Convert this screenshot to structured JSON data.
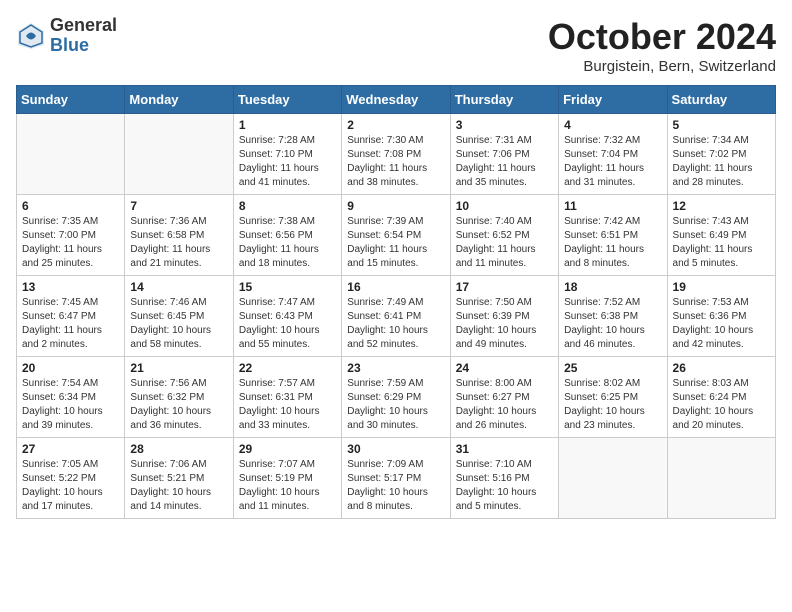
{
  "header": {
    "logo_general": "General",
    "logo_blue": "Blue",
    "month_title": "October 2024",
    "location": "Burgistein, Bern, Switzerland"
  },
  "days_of_week": [
    "Sunday",
    "Monday",
    "Tuesday",
    "Wednesday",
    "Thursday",
    "Friday",
    "Saturday"
  ],
  "weeks": [
    [
      {
        "day": "",
        "empty": true
      },
      {
        "day": "",
        "empty": true
      },
      {
        "day": "1",
        "lines": [
          "Sunrise: 7:28 AM",
          "Sunset: 7:10 PM",
          "Daylight: 11 hours",
          "and 41 minutes."
        ]
      },
      {
        "day": "2",
        "lines": [
          "Sunrise: 7:30 AM",
          "Sunset: 7:08 PM",
          "Daylight: 11 hours",
          "and 38 minutes."
        ]
      },
      {
        "day": "3",
        "lines": [
          "Sunrise: 7:31 AM",
          "Sunset: 7:06 PM",
          "Daylight: 11 hours",
          "and 35 minutes."
        ]
      },
      {
        "day": "4",
        "lines": [
          "Sunrise: 7:32 AM",
          "Sunset: 7:04 PM",
          "Daylight: 11 hours",
          "and 31 minutes."
        ]
      },
      {
        "day": "5",
        "lines": [
          "Sunrise: 7:34 AM",
          "Sunset: 7:02 PM",
          "Daylight: 11 hours",
          "and 28 minutes."
        ]
      }
    ],
    [
      {
        "day": "6",
        "lines": [
          "Sunrise: 7:35 AM",
          "Sunset: 7:00 PM",
          "Daylight: 11 hours",
          "and 25 minutes."
        ]
      },
      {
        "day": "7",
        "lines": [
          "Sunrise: 7:36 AM",
          "Sunset: 6:58 PM",
          "Daylight: 11 hours",
          "and 21 minutes."
        ]
      },
      {
        "day": "8",
        "lines": [
          "Sunrise: 7:38 AM",
          "Sunset: 6:56 PM",
          "Daylight: 11 hours",
          "and 18 minutes."
        ]
      },
      {
        "day": "9",
        "lines": [
          "Sunrise: 7:39 AM",
          "Sunset: 6:54 PM",
          "Daylight: 11 hours",
          "and 15 minutes."
        ]
      },
      {
        "day": "10",
        "lines": [
          "Sunrise: 7:40 AM",
          "Sunset: 6:52 PM",
          "Daylight: 11 hours",
          "and 11 minutes."
        ]
      },
      {
        "day": "11",
        "lines": [
          "Sunrise: 7:42 AM",
          "Sunset: 6:51 PM",
          "Daylight: 11 hours",
          "and 8 minutes."
        ]
      },
      {
        "day": "12",
        "lines": [
          "Sunrise: 7:43 AM",
          "Sunset: 6:49 PM",
          "Daylight: 11 hours",
          "and 5 minutes."
        ]
      }
    ],
    [
      {
        "day": "13",
        "lines": [
          "Sunrise: 7:45 AM",
          "Sunset: 6:47 PM",
          "Daylight: 11 hours",
          "and 2 minutes."
        ]
      },
      {
        "day": "14",
        "lines": [
          "Sunrise: 7:46 AM",
          "Sunset: 6:45 PM",
          "Daylight: 10 hours",
          "and 58 minutes."
        ]
      },
      {
        "day": "15",
        "lines": [
          "Sunrise: 7:47 AM",
          "Sunset: 6:43 PM",
          "Daylight: 10 hours",
          "and 55 minutes."
        ]
      },
      {
        "day": "16",
        "lines": [
          "Sunrise: 7:49 AM",
          "Sunset: 6:41 PM",
          "Daylight: 10 hours",
          "and 52 minutes."
        ]
      },
      {
        "day": "17",
        "lines": [
          "Sunrise: 7:50 AM",
          "Sunset: 6:39 PM",
          "Daylight: 10 hours",
          "and 49 minutes."
        ]
      },
      {
        "day": "18",
        "lines": [
          "Sunrise: 7:52 AM",
          "Sunset: 6:38 PM",
          "Daylight: 10 hours",
          "and 46 minutes."
        ]
      },
      {
        "day": "19",
        "lines": [
          "Sunrise: 7:53 AM",
          "Sunset: 6:36 PM",
          "Daylight: 10 hours",
          "and 42 minutes."
        ]
      }
    ],
    [
      {
        "day": "20",
        "lines": [
          "Sunrise: 7:54 AM",
          "Sunset: 6:34 PM",
          "Daylight: 10 hours",
          "and 39 minutes."
        ]
      },
      {
        "day": "21",
        "lines": [
          "Sunrise: 7:56 AM",
          "Sunset: 6:32 PM",
          "Daylight: 10 hours",
          "and 36 minutes."
        ]
      },
      {
        "day": "22",
        "lines": [
          "Sunrise: 7:57 AM",
          "Sunset: 6:31 PM",
          "Daylight: 10 hours",
          "and 33 minutes."
        ]
      },
      {
        "day": "23",
        "lines": [
          "Sunrise: 7:59 AM",
          "Sunset: 6:29 PM",
          "Daylight: 10 hours",
          "and 30 minutes."
        ]
      },
      {
        "day": "24",
        "lines": [
          "Sunrise: 8:00 AM",
          "Sunset: 6:27 PM",
          "Daylight: 10 hours",
          "and 26 minutes."
        ]
      },
      {
        "day": "25",
        "lines": [
          "Sunrise: 8:02 AM",
          "Sunset: 6:25 PM",
          "Daylight: 10 hours",
          "and 23 minutes."
        ]
      },
      {
        "day": "26",
        "lines": [
          "Sunrise: 8:03 AM",
          "Sunset: 6:24 PM",
          "Daylight: 10 hours",
          "and 20 minutes."
        ]
      }
    ],
    [
      {
        "day": "27",
        "lines": [
          "Sunrise: 7:05 AM",
          "Sunset: 5:22 PM",
          "Daylight: 10 hours",
          "and 17 minutes."
        ]
      },
      {
        "day": "28",
        "lines": [
          "Sunrise: 7:06 AM",
          "Sunset: 5:21 PM",
          "Daylight: 10 hours",
          "and 14 minutes."
        ]
      },
      {
        "day": "29",
        "lines": [
          "Sunrise: 7:07 AM",
          "Sunset: 5:19 PM",
          "Daylight: 10 hours",
          "and 11 minutes."
        ]
      },
      {
        "day": "30",
        "lines": [
          "Sunrise: 7:09 AM",
          "Sunset: 5:17 PM",
          "Daylight: 10 hours",
          "and 8 minutes."
        ]
      },
      {
        "day": "31",
        "lines": [
          "Sunrise: 7:10 AM",
          "Sunset: 5:16 PM",
          "Daylight: 10 hours",
          "and 5 minutes."
        ]
      },
      {
        "day": "",
        "empty": true
      },
      {
        "day": "",
        "empty": true
      }
    ]
  ]
}
